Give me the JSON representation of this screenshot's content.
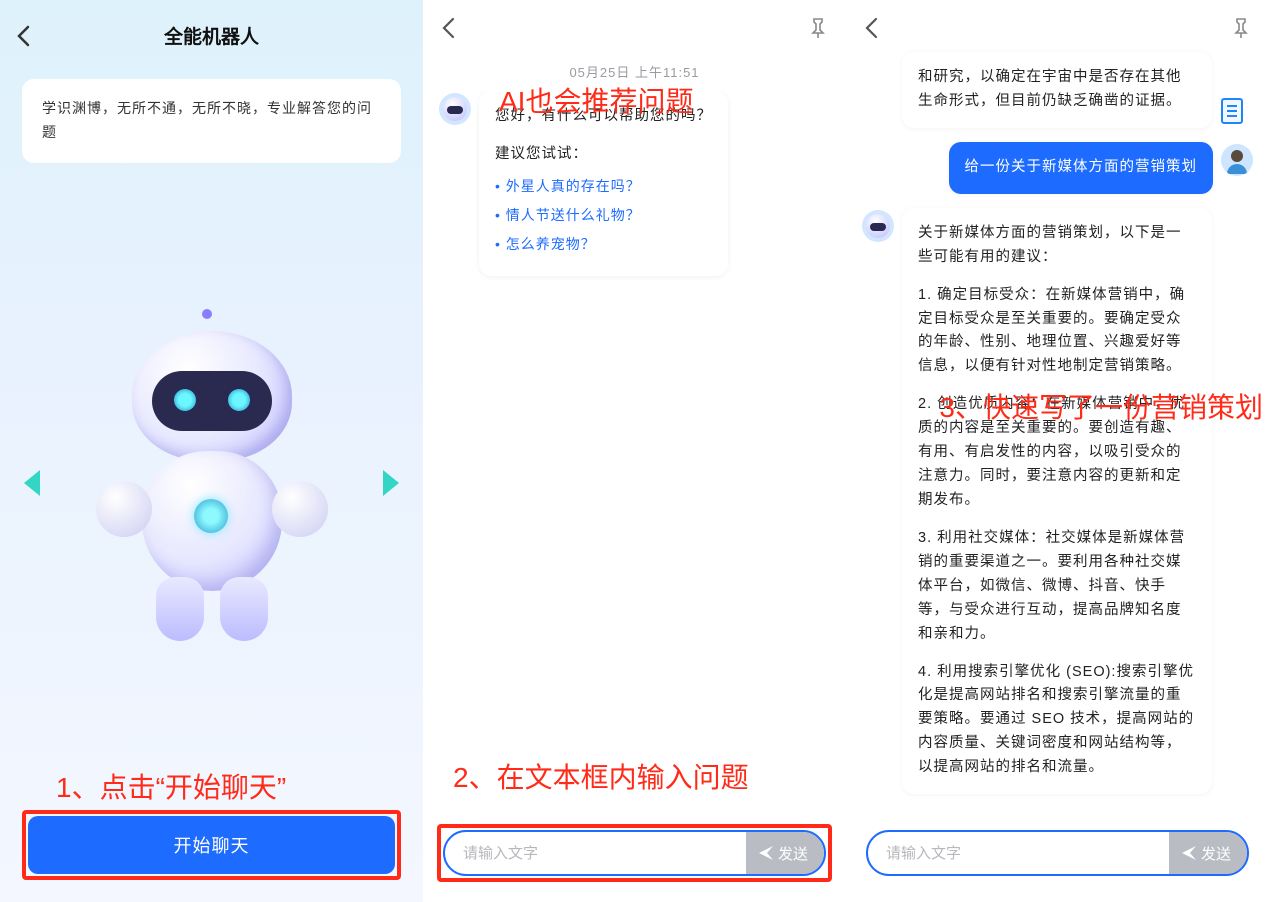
{
  "panel1": {
    "title": "全能机器人",
    "description": "学识渊博，无所不通，无所不晓，专业解答您的问题",
    "start_button": "开始聊天",
    "annotation": "1、点击“开始聊天”"
  },
  "panel2": {
    "timestamp": "05月25日  上午11:51",
    "annotation_top": "AI也会推荐问题",
    "greeting": "您好，有什么可以帮助您的吗？",
    "suggest_head": "建议您试试：",
    "suggestions": [
      "外星人真的存在吗？",
      "情人节送什么礼物？",
      "怎么养宠物？"
    ],
    "annotation_bottom": "2、在文本框内输入问题",
    "input_placeholder": "请输入文字",
    "send_label": "发送"
  },
  "panel3": {
    "prev_tail": "和研究，以确定在宇宙中是否存在其他生命形式，但目前仍缺乏确凿的证据。",
    "user_msg": "给一份关于新媒体方面的营销策划",
    "reply_intro": "关于新媒体方面的营销策划，以下是一些可能有用的建议：",
    "reply_items": [
      "1. 确定目标受众：在新媒体营销中，确定目标受众是至关重要的。要确定受众的年龄、性别、地理位置、兴趣爱好等信息，以便有针对性地制定营销策略。",
      "2. 创造优质内容：在新媒体营销中，优质的内容是至关重要的。要创造有趣、有用、有启发性的内容，以吸引受众的注意力。同时，要注意内容的更新和定期发布。",
      "3. 利用社交媒体：社交媒体是新媒体营销的重要渠道之一。要利用各种社交媒体平台，如微信、微博、抖音、快手等，与受众进行互动，提高品牌知名度和亲和力。",
      "4. 利用搜索引擎优化 (SEO):搜索引擎优化是提高网站排名和搜索引擎流量的重要策略。要通过 SEO 技术，提高网站的内容质量、关键词密度和网站结构等，以提高网站的排名和流量。"
    ],
    "annotation": "3、快速写了一份营销策划",
    "input_placeholder": "请输入文字",
    "send_label": "发送"
  }
}
